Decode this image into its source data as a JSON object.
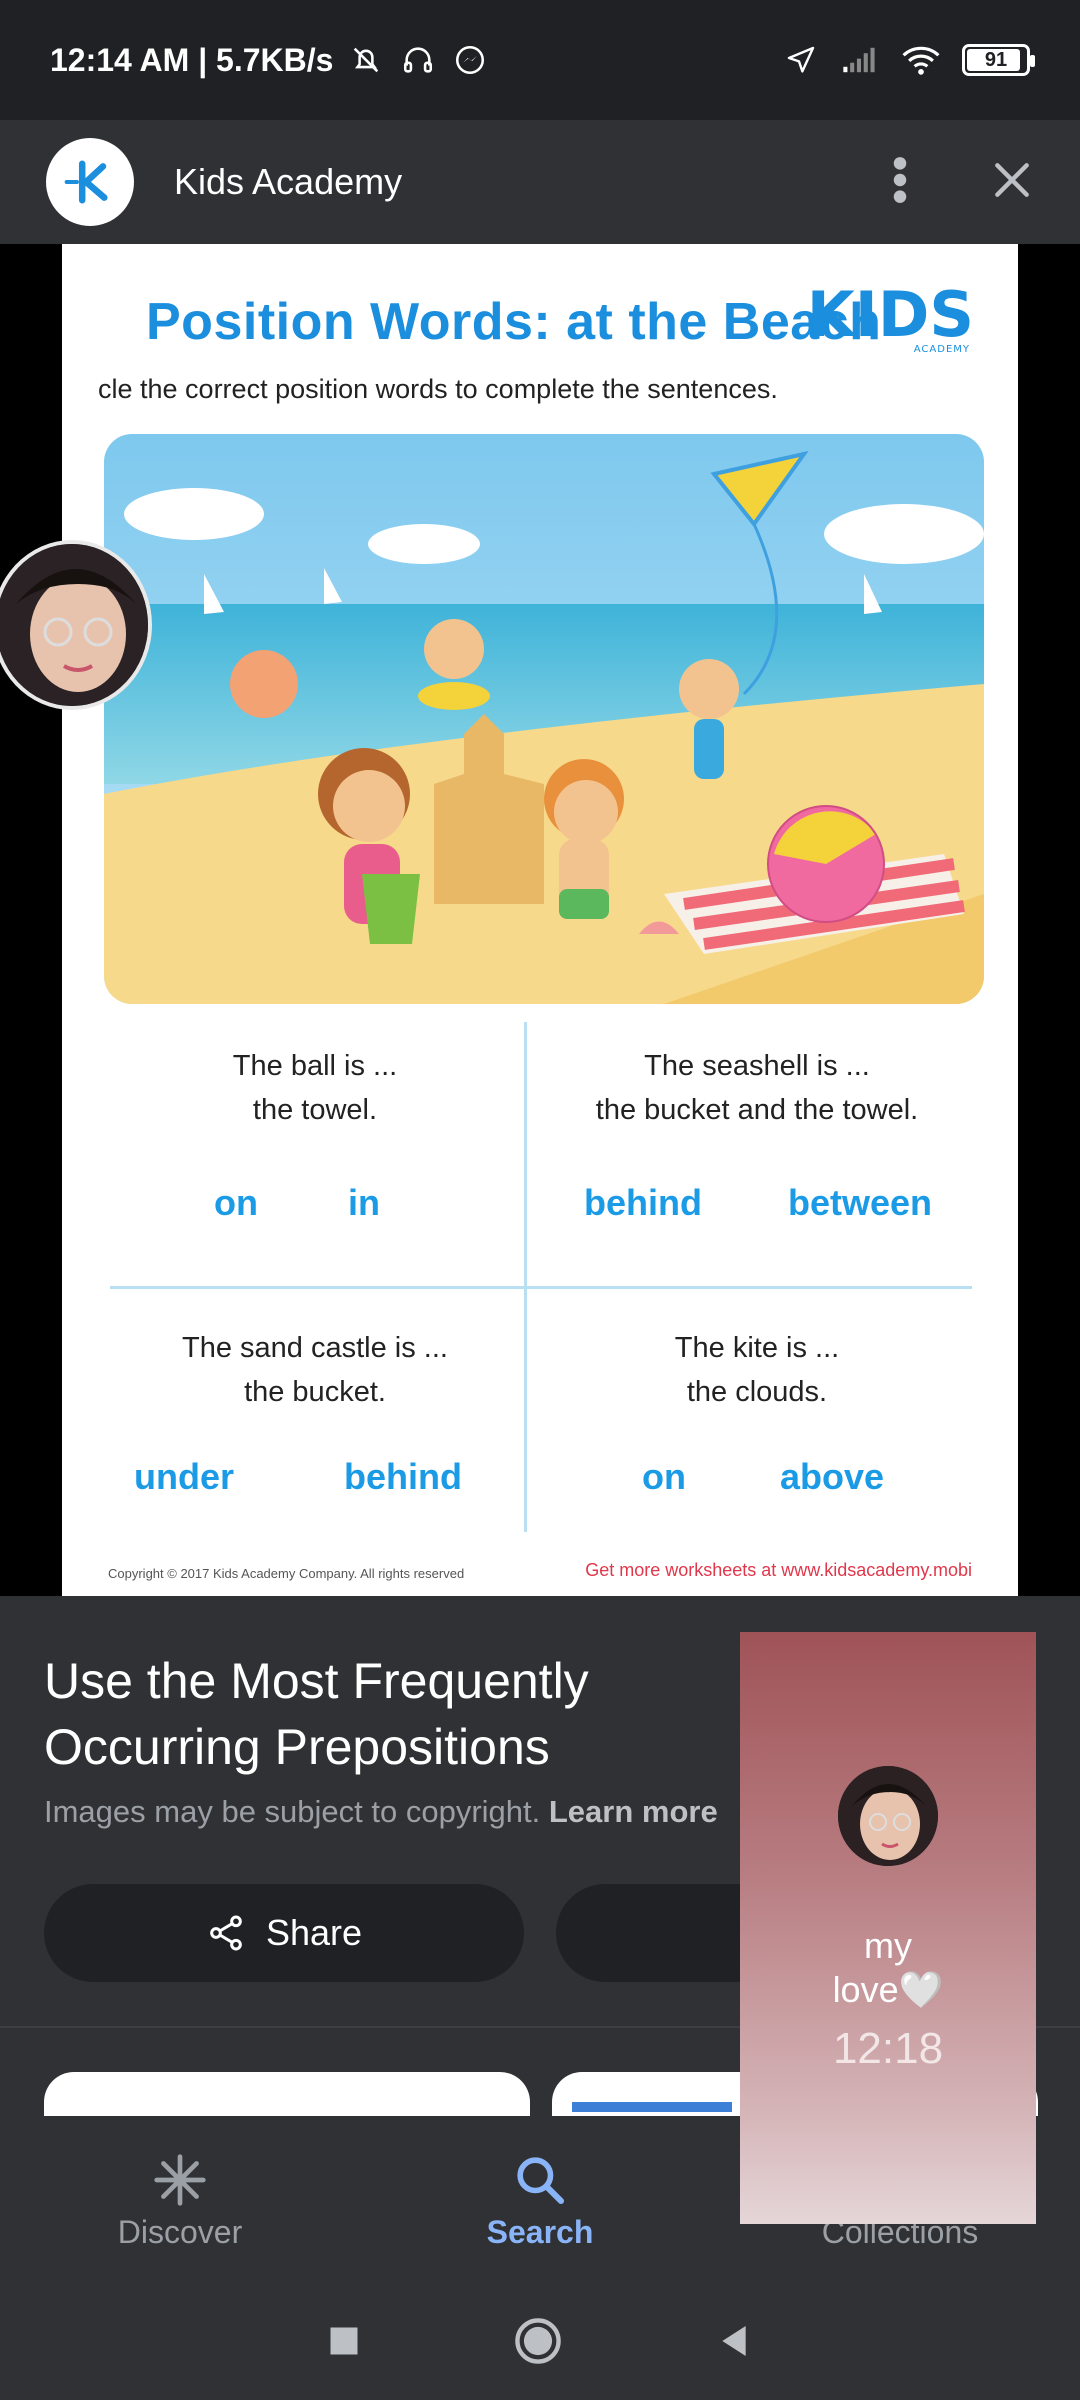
{
  "status_bar": {
    "time": "12:14 AM | 5.7KB/s",
    "battery": "91",
    "icons": [
      "mute-bell-icon",
      "headphones-icon",
      "messenger-icon",
      "location-icon",
      "signal-icon",
      "wifi-icon",
      "battery-icon"
    ]
  },
  "app_header": {
    "title": "Kids Academy",
    "icons": [
      "kids-academy-logo",
      "more-vert-icon",
      "close-icon"
    ]
  },
  "worksheet": {
    "title": "Position Words: at the Beach",
    "logo_text": "KIDS",
    "logo_sub": "ACADEMY",
    "instructions": "cle the correct position words to complete the sentences.",
    "questions": [
      {
        "line1": "The ball is ...",
        "line2": "the towel.",
        "options": [
          "on",
          "in"
        ]
      },
      {
        "line1": "The seashell is ...",
        "line2": "the bucket and the towel.",
        "options": [
          "behind",
          "between"
        ]
      },
      {
        "line1": "The sand castle is ...",
        "line2": "the bucket.",
        "options": [
          "under",
          "behind"
        ]
      },
      {
        "line1": "The kite is ...",
        "line2": "the clouds.",
        "options": [
          "on",
          "above"
        ]
      }
    ],
    "copyright": "Copyright © 2017 Kids Academy Company. All rights reserved",
    "more": "Get more worksheets at www.kidsacademy.mobi"
  },
  "details": {
    "title": "Use the Most Frequently Occurring Prepositions",
    "copyright_text": "Images may be subject to copyright.",
    "learn_more": "Learn more",
    "share_label": "Share"
  },
  "bottom_nav": {
    "items": [
      {
        "label": "Discover",
        "icon": "asterisk-icon",
        "active": false
      },
      {
        "label": "Search",
        "icon": "search-icon",
        "active": true
      },
      {
        "label": "Collections",
        "icon": "bookmark-icon",
        "active": false
      }
    ]
  },
  "chat_widget": {
    "name_line1": "my",
    "name_line2": "love🤍",
    "time": "12:18"
  },
  "colors": {
    "accent": "#8ab4f8",
    "worksheet_blue": "#1b8ede",
    "worksheet_red": "#e0374b"
  }
}
